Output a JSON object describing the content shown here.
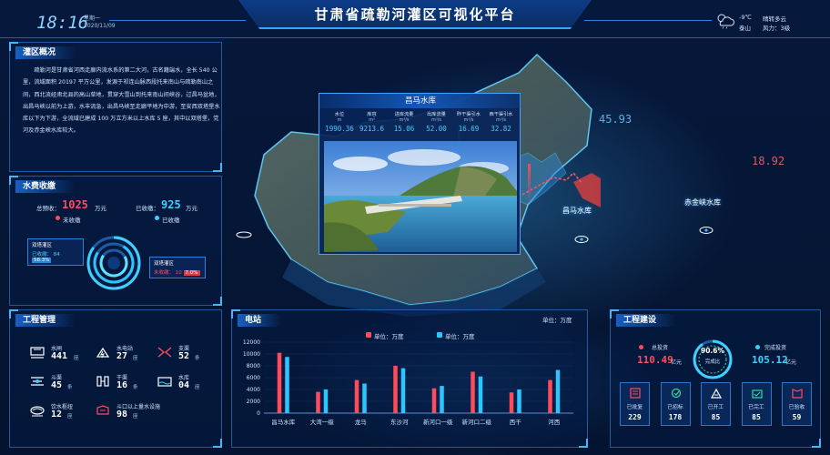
{
  "header": {
    "title": "甘肃省疏勒河灌区可视化平台",
    "time": "18:16",
    "weekday": "星期一",
    "date": "2020/11/09",
    "weather": {
      "icon": "partly-cloudy-rain-icon",
      "temp": "-9℃",
      "place": "泰山",
      "desc": "晴转多云",
      "wind": "风力：3级"
    }
  },
  "overview": {
    "title": "灌区概况",
    "text": "疏勒河是甘肃省河西走廊内流水系的第二大河，古名籍端水，全长 540 公里，流域面积 20197 平方公里，发源于祁连山脉西段托来南山与疏勒南山之间，西北流经肃北县的高山草地，贯穿大雪山到托来南山间峡谷，过昌马盆地，出昌马峡以前为上游，水丰流急，出昌马峡至走廊平地为中游，至安西双塔堡水库以下为下游，全流域已建成 100 万立方米以上水库 5 座，其中以双塔堡，党河及赤金峡水库较大。"
  },
  "fees": {
    "title": "水费收缴",
    "total_label": "总预收：",
    "total_value": "1025",
    "total_unit": "万元",
    "collected_label": "已收缴：",
    "collected_value": "925",
    "collected_unit": "万元",
    "legend_uncollected": "未收缴",
    "legend_collected": "已收缴",
    "box1": {
      "title": "双塔灌区",
      "label": "已收缴：",
      "value": "84",
      "pct": "58.3%"
    },
    "box2": {
      "title": "双塔灌区",
      "label": "未收缴：",
      "value": "10",
      "pct": "7.0%"
    },
    "colors": {
      "uncollected": "#ff3b4f",
      "collected": "#3fd0ff"
    }
  },
  "engineering": {
    "title": "工程管理",
    "items": [
      {
        "name": "水闸",
        "value": "441",
        "unit": "座",
        "icon": "sluice-gate-icon"
      },
      {
        "name": "水电站",
        "value": "27",
        "unit": "座",
        "icon": "hydropower-station-icon"
      },
      {
        "name": "支渠",
        "value": "52",
        "unit": "条",
        "icon": "branch-canal-icon"
      },
      {
        "name": "斗渠",
        "value": "45",
        "unit": "条",
        "icon": "lateral-canal-icon"
      },
      {
        "name": "干渠",
        "value": "16",
        "unit": "条",
        "icon": "main-canal-icon"
      },
      {
        "name": "水库",
        "value": "04",
        "unit": "座",
        "icon": "reservoir-icon"
      },
      {
        "name": "饮水枢纽",
        "value": "12",
        "unit": "座",
        "icon": "water-hub-icon"
      },
      {
        "name": "斗口以上量水设施",
        "value": "98",
        "unit": "座",
        "icon": "water-meter-icon"
      }
    ]
  },
  "reservoir": {
    "title": "昌马水库",
    "stats": [
      {
        "label": "水位",
        "unit": "m",
        "value": "1990.36"
      },
      {
        "label": "库容",
        "unit": "m³",
        "value": "9213.6"
      },
      {
        "label": "进库流量",
        "unit": "m³/s",
        "value": "15.06"
      },
      {
        "label": "出库流量",
        "unit": "m³/s",
        "value": "52.00"
      },
      {
        "label": "昨干渠引水",
        "unit": "m³/s",
        "value": "16.69"
      },
      {
        "label": "西干渠引水",
        "unit": "m³/s",
        "value": "32.82"
      }
    ]
  },
  "map": {
    "labels": {
      "changma": "昌马水库",
      "chijinxia": "赤金峡水库"
    },
    "numbers": {
      "left": "45.93",
      "right": "18.92"
    }
  },
  "power": {
    "title": "电站",
    "unit_label": "单位：万度",
    "legend": [
      {
        "name": "单位：万度",
        "color": "#ff4b5c"
      },
      {
        "name": "单位：万度",
        "color": "#2ec4ff"
      }
    ]
  },
  "chart_data": {
    "type": "bar",
    "categories": [
      "昌马水库",
      "大湾一级",
      "龙马",
      "东沙河",
      "新河口一级",
      "新河口二级",
      "西干",
      "河西"
    ],
    "series": [
      {
        "name": "单位：万度",
        "values": [
          10200,
          3600,
          5600,
          8000,
          4200,
          7000,
          3500,
          5600
        ]
      },
      {
        "name": "单位：万度",
        "values": [
          9500,
          4000,
          5000,
          7600,
          4600,
          6200,
          4000,
          7300
        ]
      }
    ],
    "ylim": [
      0,
      12000
    ],
    "yticks": [
      "0",
      "2000",
      "4000",
      "6000",
      "8000",
      "10000",
      "12000"
    ],
    "colors": [
      "#ff4b5c",
      "#2ec4ff"
    ]
  },
  "project": {
    "title": "工程建设",
    "total_label": "总投资",
    "total_value": "110.49",
    "total_unit": "亿元",
    "done_label": "完成投资",
    "done_value": "105.12",
    "done_unit": "亿元",
    "ratio_value": "90.6%",
    "ratio_fraction": 0.906,
    "ratio_label": "完成比",
    "boxes": [
      {
        "label": "已批复",
        "value": "229",
        "icon": "approved-icon"
      },
      {
        "label": "已招标",
        "value": "178",
        "icon": "bidding-icon"
      },
      {
        "label": "已开工",
        "value": "85",
        "icon": "started-icon"
      },
      {
        "label": "已完工",
        "value": "85",
        "icon": "completed-icon"
      },
      {
        "label": "已验收",
        "value": "59",
        "icon": "accepted-icon"
      }
    ]
  }
}
